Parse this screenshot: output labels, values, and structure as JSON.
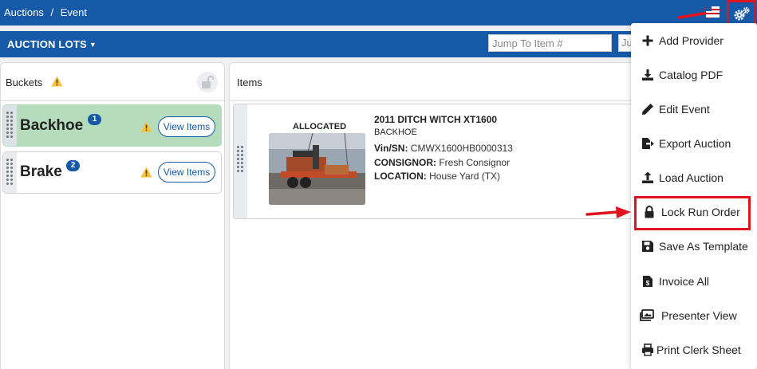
{
  "breadcrumb": {
    "home": "Auctions",
    "separator": "/",
    "current": "Event"
  },
  "toolbar": {
    "lots_label": "AUCTION LOTS",
    "jump_placeholder": "Jump To Item #",
    "jump2_text": "Ju"
  },
  "buckets_panel": {
    "title": "Buckets",
    "items": [
      {
        "name": "Backhoe",
        "count": "1",
        "view_label": "View Items",
        "active": true
      },
      {
        "name": "Brake",
        "count": "2",
        "view_label": "View Items",
        "active": false
      }
    ]
  },
  "items_panel": {
    "title": "Items",
    "item": {
      "status": "ALLOCATED",
      "title": "2011 DITCH WITCH XT1600",
      "category": "BACKHOE",
      "vin_label": "Vin/SN:",
      "vin_value": "CMWX1600HB0000313",
      "consignor_label": "CONSIGNOR:",
      "consignor_value": "Fresh Consignor",
      "location_label": "LOCATION:",
      "location_value": "House Yard (TX)"
    }
  },
  "menu": {
    "items": [
      {
        "label": "Add Provider",
        "icon": "plus-icon"
      },
      {
        "label": "Catalog PDF",
        "icon": "download-icon"
      },
      {
        "label": "Edit Event",
        "icon": "pencil-icon"
      },
      {
        "label": "Export Auction",
        "icon": "file-export-icon"
      },
      {
        "label": "Load Auction",
        "icon": "upload-icon"
      },
      {
        "label": "Lock Run Order",
        "icon": "lock-icon"
      },
      {
        "label": "Save As Template",
        "icon": "save-icon"
      },
      {
        "label": "Invoice All",
        "icon": "invoice-icon"
      },
      {
        "label": "Presenter View",
        "icon": "images-icon"
      },
      {
        "label": "Print Clerk Sheet",
        "icon": "print-icon"
      }
    ]
  },
  "colors": {
    "primary": "#1559a8",
    "active_bucket": "#b5dcbc",
    "warning": "#f6c142",
    "annotation_red": "#e0141e"
  }
}
